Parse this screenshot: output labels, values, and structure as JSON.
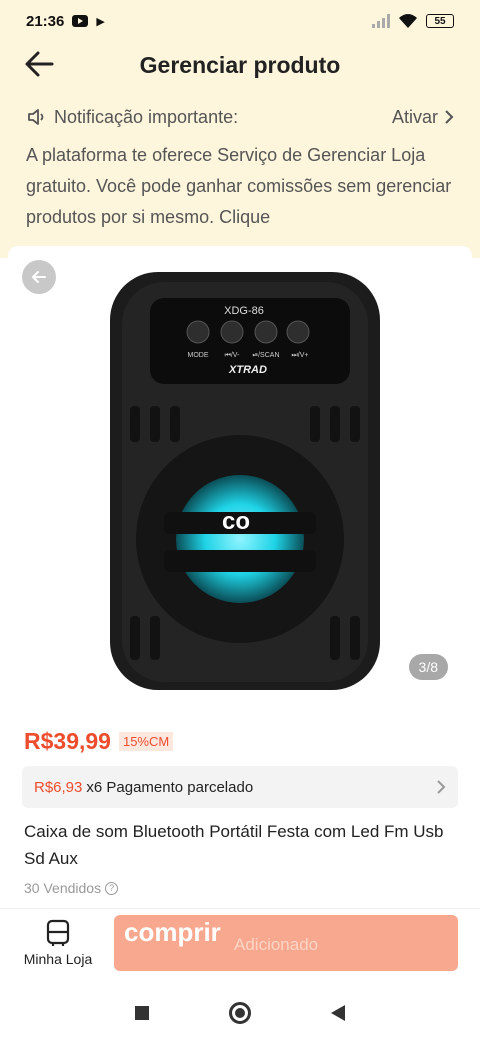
{
  "status_bar": {
    "time": "21:36",
    "battery": "55"
  },
  "header": {
    "title": "Gerenciar produto"
  },
  "notice": {
    "label": "Notificação importante:",
    "action": "Ativar",
    "text": "A plataforma te oferece Serviço de Gerenciar Loja gratuito. Você pode ganhar comissões sem gerenciar produtos por si mesmo. Clique"
  },
  "product_image": {
    "model_label": "XDG-86",
    "brand": "XTRAD",
    "button_labels": [
      "MODE",
      "⏮/V-",
      "⏯/SCAN",
      "⏭/V+"
    ],
    "overlay_text": "co",
    "counter": "3/8"
  },
  "price": {
    "value": "R$39,99",
    "discount": "15%CM"
  },
  "installment": {
    "amount": "R$6,93",
    "text": "x6 Pagamento parcelado"
  },
  "product": {
    "name": "Caixa de som Bluetooth Portátil Festa com Led Fm Usb Sd Aux",
    "sold": "30 Vendidos"
  },
  "bottom_bar": {
    "store_label": "Minha Loja",
    "buy_label": "comprir",
    "added_label": "Adicionado"
  },
  "colors": {
    "accent": "#ee4d2d",
    "notice_bg": "#fdf5dc",
    "buy_button": "#f8a88e"
  },
  "icons": [
    "back-arrow-icon",
    "speaker-icon",
    "chevron-right-icon",
    "store-icon",
    "help-icon"
  ]
}
